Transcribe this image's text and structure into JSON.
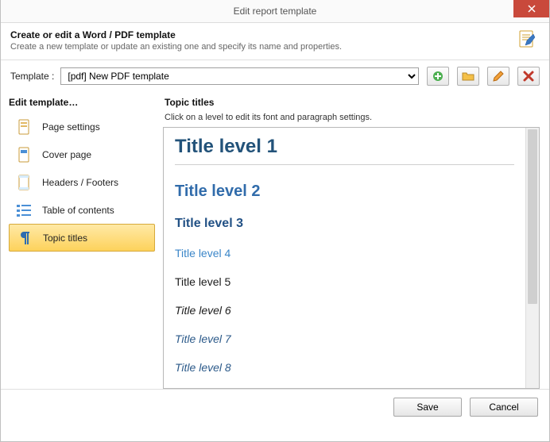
{
  "window": {
    "title": "Edit report template"
  },
  "header": {
    "heading": "Create or edit a Word / PDF template",
    "sub": "Create a new template or update an existing one and specify its name and properties."
  },
  "template": {
    "label": "Template :",
    "selected": "[pdf] New PDF template"
  },
  "sidebar": {
    "title": "Edit template…",
    "items": [
      {
        "label": "Page settings"
      },
      {
        "label": "Cover page"
      },
      {
        "label": "Headers / Footers"
      },
      {
        "label": "Table of contents"
      },
      {
        "label": "Topic titles"
      }
    ]
  },
  "right": {
    "title": "Topic titles",
    "hint": "Click on a level to edit its font and paragraph settings.",
    "levels": {
      "l1": "Title level 1",
      "l2": "Title level 2",
      "l3": "Title level 3",
      "l4": "Title level 4",
      "l5": "Title level 5",
      "l6": "Title level 6",
      "l7": "Title level 7",
      "l8": "Title level 8"
    }
  },
  "footer": {
    "save": "Save",
    "cancel": "Cancel"
  }
}
